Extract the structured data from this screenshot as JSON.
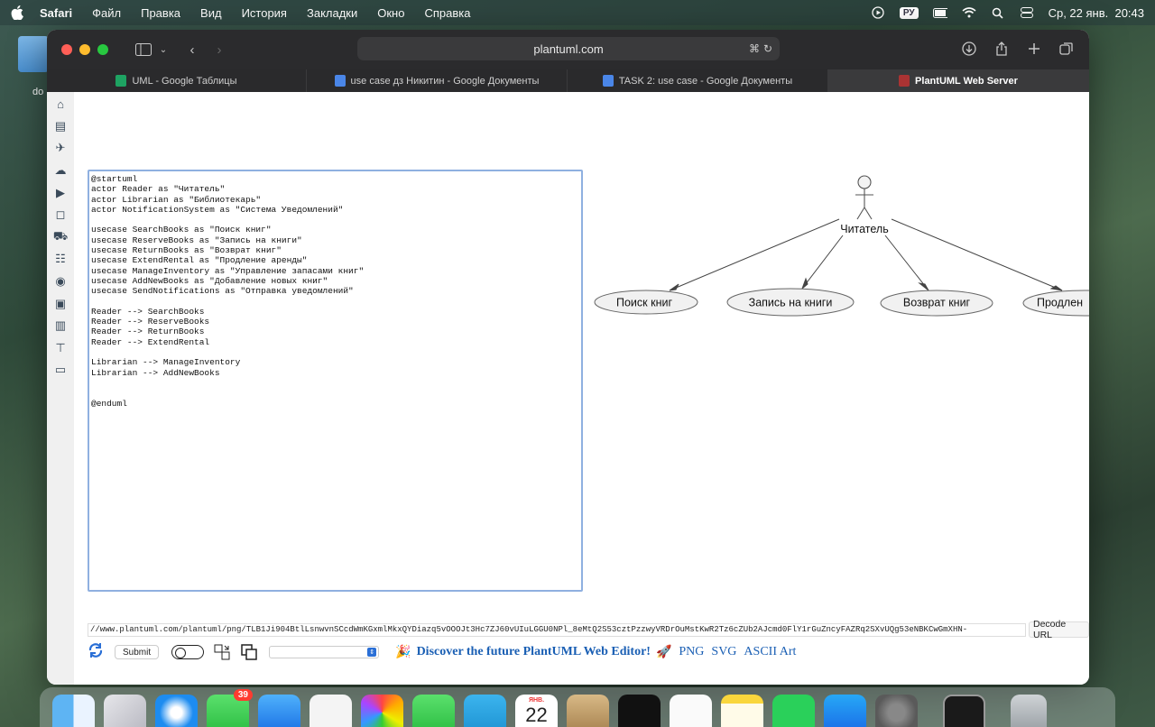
{
  "menubar": {
    "app_name": "Safari",
    "items": [
      "Файл",
      "Правка",
      "Вид",
      "История",
      "Закладки",
      "Окно",
      "Справка"
    ],
    "input_lang": "РУ",
    "datetime": "Ср, 22 янв.  20:43"
  },
  "desktop": {
    "folder_label": "do"
  },
  "browser": {
    "address": "plantuml.com",
    "tabs": [
      {
        "label": "UML - Google Таблицы",
        "icon": "google-sheets-icon",
        "color": "#1ea362"
      },
      {
        "label": "use case дз Никитин - Google Документы",
        "icon": "google-docs-icon",
        "color": "#4a86e8"
      },
      {
        "label": "TASK 2: use case - Google Документы",
        "icon": "google-docs-icon",
        "color": "#4a86e8"
      },
      {
        "label": "PlantUML Web Server",
        "icon": "plantuml-icon",
        "color": "#a33"
      }
    ]
  },
  "editor": {
    "lines": [
      "@startuml",
      "actor Reader as \"Читатель\"",
      "actor Librarian as \"Библиотекарь\"",
      "actor NotificationSystem as \"Система Уведомлений\"",
      "",
      "usecase SearchBooks as \"Поиск книг\"",
      "usecase ReserveBooks as \"Запись на книги\"",
      "usecase ReturnBooks as \"Возврат книг\"",
      "usecase ExtendRental as \"Продление аренды\"",
      "usecase ManageInventory as \"Управление запасами книг\"",
      "usecase AddNewBooks as \"Добавление новых книг\"",
      "usecase SendNotifications as \"Отправка уведомлений\"",
      "",
      "Reader --> SearchBooks",
      "Reader --> ReserveBooks",
      "Reader --> ReturnBooks",
      "Reader --> ExtendRental",
      "",
      "Librarian --> ManageInventory",
      "Librarian --> AddNewBooks",
      "",
      "",
      "@enduml"
    ]
  },
  "diagram": {
    "actor_label": "Читатель",
    "usecases": [
      "Поиск книг",
      "Запись на книги",
      "Возврат книг",
      "Продлен"
    ]
  },
  "url_bar": {
    "value": "//www.plantuml.com/plantuml/png/TLB1Ji904BtlLsnwvnSCcdWmKGxmlMkxQYDiazq5vOOOJt3Hc7ZJ60vUIuLGGU0NPl_8eMtQ2S53cztPzzwyVRDrOuMstKwR2Tz6cZUb2AJcmd0FlY1rGuZncyFAZRq2SXvUQg53eNBKCwGmXHN-",
    "decode_label": "Decode URL"
  },
  "controls": {
    "submit_label": "Submit",
    "promo_text": "Discover the future PlantUML Web Editor!",
    "formats": [
      "PNG",
      "SVG",
      "ASCII Art"
    ]
  },
  "dock": {
    "messages_badge": "39",
    "calendar_month": "ЯНВ.",
    "calendar_day": "22"
  }
}
